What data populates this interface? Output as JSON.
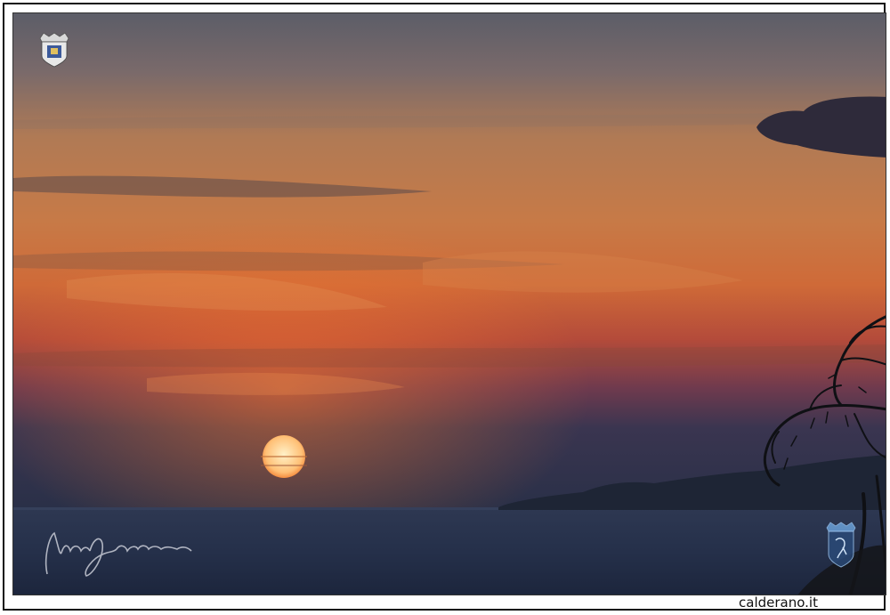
{
  "watermark": {
    "site": "calderano.it"
  },
  "icons": {
    "crest_top_left": "crest-icon",
    "crest_bottom_right": "crest-icon",
    "signature": "signature-icon"
  },
  "colors": {
    "sky_top": "#6b6368",
    "sky_orange": "#d7733c",
    "sun": "#ffd9a0",
    "sea": "#23314a",
    "land": "#1f2738"
  }
}
